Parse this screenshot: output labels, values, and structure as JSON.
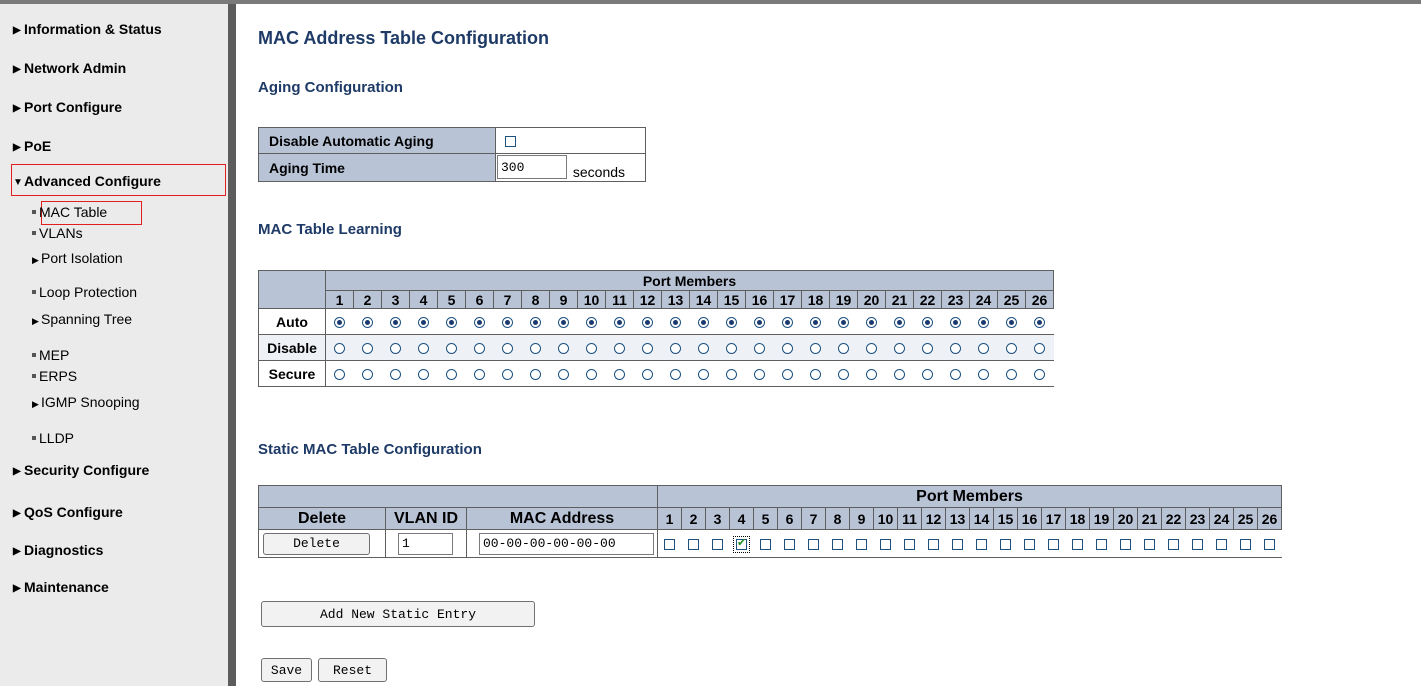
{
  "sidebar": {
    "top_items": [
      {
        "label": "Information & Status",
        "expanded": false
      },
      {
        "label": "Network Admin",
        "expanded": false
      },
      {
        "label": "Port Configure",
        "expanded": false
      },
      {
        "label": "PoE",
        "expanded": false
      },
      {
        "label": "Advanced Configure",
        "expanded": true
      },
      {
        "label": "Security Configure",
        "expanded": false
      },
      {
        "label": "QoS Configure",
        "expanded": false
      },
      {
        "label": "Diagnostics",
        "expanded": false
      },
      {
        "label": "Maintenance",
        "expanded": false
      }
    ],
    "sub_items": [
      {
        "label": "MAC Table",
        "kind": "page",
        "active": true
      },
      {
        "label": "VLANs",
        "kind": "page"
      },
      {
        "label": "Port Isolation",
        "kind": "folder"
      },
      {
        "label": "Loop Protection",
        "kind": "page"
      },
      {
        "label": "Spanning Tree",
        "kind": "folder"
      },
      {
        "label": "MEP",
        "kind": "page"
      },
      {
        "label": "ERPS",
        "kind": "page"
      },
      {
        "label": "IGMP Snooping",
        "kind": "folder"
      },
      {
        "label": "LLDP",
        "kind": "page"
      }
    ]
  },
  "page": {
    "title": "MAC Address Table Configuration",
    "aging": {
      "heading": "Aging Configuration",
      "disable_label": "Disable Automatic Aging",
      "disable_checked": false,
      "time_label": "Aging Time",
      "time_value": "300",
      "time_unit": "seconds"
    },
    "learning": {
      "heading": "MAC Table Learning",
      "port_members_label": "Port Members",
      "ports": [
        "1",
        "2",
        "3",
        "4",
        "5",
        "6",
        "7",
        "8",
        "9",
        "10",
        "11",
        "12",
        "13",
        "14",
        "15",
        "16",
        "17",
        "18",
        "19",
        "20",
        "21",
        "22",
        "23",
        "24",
        "25",
        "26"
      ],
      "rows": [
        {
          "label": "Auto",
          "selected": true
        },
        {
          "label": "Disable",
          "selected": false
        },
        {
          "label": "Secure",
          "selected": false
        }
      ]
    },
    "static": {
      "heading": "Static MAC Table Configuration",
      "col_delete": "Delete",
      "col_vlan": "VLAN ID",
      "col_mac": "MAC Address",
      "port_members_label": "Port Members",
      "row": {
        "delete_button": "Delete",
        "vlan_value": "1",
        "mac_value": "00-00-00-00-00-00",
        "checked_ports": [
          "4"
        ]
      }
    },
    "add_button": "Add New Static Entry",
    "save_button": "Save",
    "reset_button": "Reset"
  }
}
